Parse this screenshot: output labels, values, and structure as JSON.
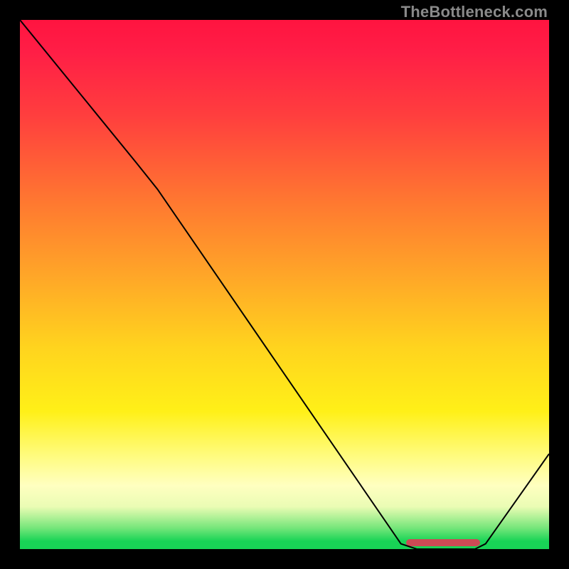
{
  "attribution": "TheBottleneck.com",
  "chart_data": {
    "type": "line",
    "title": "",
    "xlabel": "",
    "ylabel": "",
    "xlim": [
      0,
      100
    ],
    "ylim": [
      0,
      100
    ],
    "gradient_stops": [
      {
        "pos": 0,
        "color": "#ff1440"
      },
      {
        "pos": 6,
        "color": "#ff1e46"
      },
      {
        "pos": 18,
        "color": "#ff3e3e"
      },
      {
        "pos": 35,
        "color": "#ff7a30"
      },
      {
        "pos": 48,
        "color": "#ffa528"
      },
      {
        "pos": 62,
        "color": "#ffd41e"
      },
      {
        "pos": 74,
        "color": "#fff018"
      },
      {
        "pos": 82,
        "color": "#fffb7a"
      },
      {
        "pos": 88,
        "color": "#ffffc0"
      },
      {
        "pos": 92,
        "color": "#eafcb4"
      },
      {
        "pos": 96,
        "color": "#76e67a"
      },
      {
        "pos": 98.5,
        "color": "#18d456"
      },
      {
        "pos": 100,
        "color": "#18d456"
      }
    ],
    "series": [
      {
        "name": "bottleneck-curve",
        "points": [
          {
            "x": 0,
            "y": 100
          },
          {
            "x": 22,
            "y": 73
          },
          {
            "x": 26,
            "y": 68
          },
          {
            "x": 72,
            "y": 1
          },
          {
            "x": 75,
            "y": 0
          },
          {
            "x": 86,
            "y": 0
          },
          {
            "x": 88,
            "y": 1
          },
          {
            "x": 100,
            "y": 18
          }
        ]
      }
    ],
    "marker": {
      "x_start": 73,
      "x_end": 87,
      "y": 0,
      "color": "#cc4b55"
    }
  }
}
